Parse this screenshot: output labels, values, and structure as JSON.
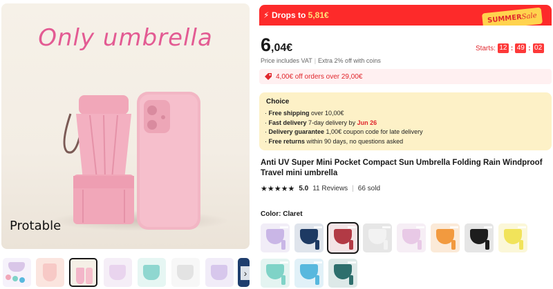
{
  "gallery": {
    "main_title": "Only umbrella",
    "main_caption": "Protable",
    "thumbnails": [
      {
        "color": "#d9c6e8"
      },
      {
        "color": "#f7c9c6"
      },
      {
        "color": "#f3b5c9"
      },
      {
        "color": "#e9d4ee"
      },
      {
        "color": "#8fd7d0"
      },
      {
        "color": "#f1f1f1"
      },
      {
        "color": "#d7c7ec"
      },
      {
        "color": "#1f3e6e"
      }
    ],
    "next_arrow": "›"
  },
  "banner": {
    "bolt_icon": "lightning-icon",
    "text_prefix": "Drops to ",
    "price": "5,81€",
    "tag_word1": "SUMMER",
    "tag_word2": "Sale"
  },
  "price": {
    "integer": "6",
    "fraction": ",04€",
    "vat_text": "Price includes VAT",
    "coins_text": "Extra 2% off with coins"
  },
  "countdown": {
    "label": "Starts:",
    "hours": "12",
    "minutes": "49",
    "seconds": "02"
  },
  "coupon": {
    "icon": "tag-icon",
    "text": "4,00€ off orders over 29,00€"
  },
  "choice": {
    "title": "Choice",
    "items": [
      {
        "bold": "Free shipping",
        "rest": " over 10,00€"
      },
      {
        "bold": "Fast delivery",
        "rest": " 7-day delivery by ",
        "highlight": "Jun 26"
      },
      {
        "bold": "Delivery guarantee",
        "rest": "  1,00€ coupon code for late delivery"
      },
      {
        "bold": "Free returns",
        "rest": "  within 90 days, no questions asked"
      }
    ]
  },
  "product": {
    "title": "Anti UV Super Mini Pocket Compact Sun Umbrella Folding Rain Windproof Travel mini umbrella",
    "stars": "★★★★★",
    "rating": "5.0",
    "reviews": "11 Reviews",
    "sold": "66 sold"
  },
  "colors": {
    "label": "Color: Claret",
    "swatches": [
      {
        "name": "purple",
        "color": "#c9b6e6",
        "bg": "#f1edf7"
      },
      {
        "name": "navy",
        "color": "#1d3a63",
        "bg": "#dfe4ec"
      },
      {
        "name": "claret",
        "color": "#b23a45",
        "bg": "#f4e4e6"
      },
      {
        "name": "white",
        "color": "#f2f2f2",
        "bg": "#e6e6e6"
      },
      {
        "name": "pink",
        "color": "#e8c9e6",
        "bg": "#f6eef5"
      },
      {
        "name": "orange",
        "color": "#f29a3f",
        "bg": "#fbead8"
      },
      {
        "name": "black",
        "color": "#1d1d1d",
        "bg": "#e5e5e5"
      },
      {
        "name": "yellow",
        "color": "#f1e35a",
        "bg": "#fbf7d8"
      },
      {
        "name": "mint",
        "color": "#7fd3c7",
        "bg": "#e4f4f1"
      },
      {
        "name": "sky-blue",
        "color": "#58b8de",
        "bg": "#e1f1f8"
      },
      {
        "name": "teal",
        "color": "#2e6f6d",
        "bg": "#dde9e8"
      }
    ]
  }
}
